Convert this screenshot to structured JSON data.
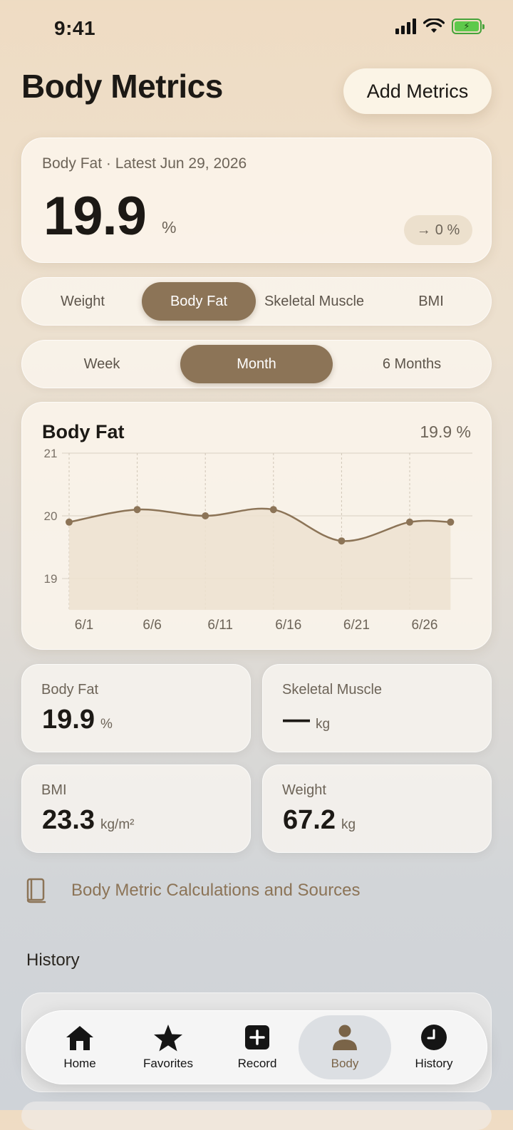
{
  "status": {
    "time": "9:41"
  },
  "header": {
    "title": "Body Metrics",
    "add_button": "Add Metrics"
  },
  "summary": {
    "subtitle": "Body Fat · Latest Jun 29, 2026",
    "value": "19.9",
    "unit": "%",
    "change": "0 %"
  },
  "metric_tabs": [
    "Weight",
    "Body Fat",
    "Skeletal Muscle",
    "BMI"
  ],
  "metric_selected": "Body Fat",
  "range_tabs": [
    "Week",
    "Month",
    "6 Months"
  ],
  "range_selected": "Month",
  "chart_data": {
    "type": "area",
    "title": "Body Fat",
    "current_value": "19.9 %",
    "ylim": [
      19,
      21
    ],
    "yticks": [
      "21",
      "20",
      "19"
    ],
    "xticks": [
      "6/1",
      "6/6",
      "6/11",
      "6/16",
      "6/21",
      "6/26"
    ],
    "x": [
      "6/1",
      "6/6",
      "6/11",
      "6/16",
      "6/21",
      "6/26",
      "6/29"
    ],
    "values": [
      19.9,
      20.1,
      20.0,
      20.1,
      19.6,
      19.9,
      19.9
    ],
    "grid": true,
    "color": "#8c7457",
    "fill": "#ede2d0"
  },
  "tiles": {
    "body_fat": {
      "label": "Body Fat",
      "value": "19.9",
      "unit": "%"
    },
    "skeletal_muscle": {
      "label": "Skeletal Muscle",
      "value": "—",
      "unit": "kg"
    },
    "bmi": {
      "label": "BMI",
      "value": "23.3",
      "unit": "kg/m²"
    },
    "weight": {
      "label": "Weight",
      "value": "67.2",
      "unit": "kg"
    }
  },
  "sources_link": "Body Metric Calculations and Sources",
  "history_heading": "History",
  "tabbar": {
    "home": "Home",
    "favorites": "Favorites",
    "record": "Record",
    "body": "Body",
    "history": "History"
  },
  "colors": {
    "accent": "#8c7457",
    "battery": "#5ec94b"
  }
}
